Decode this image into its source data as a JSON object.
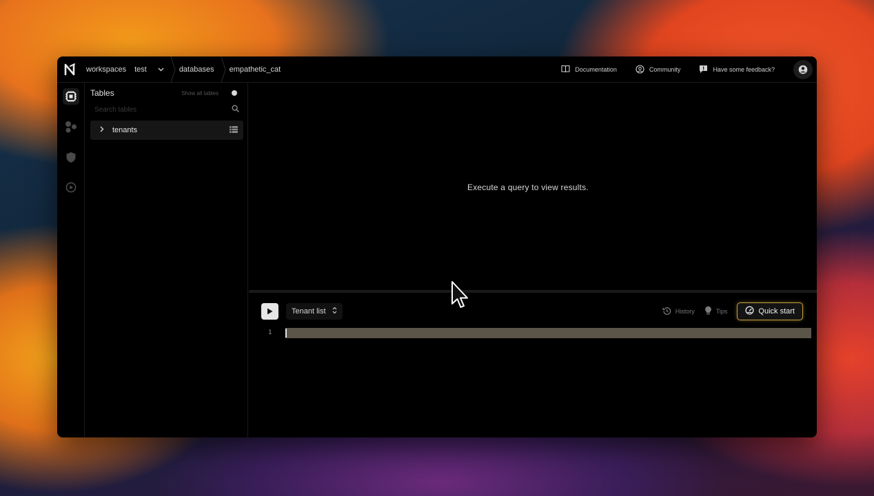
{
  "topbar": {
    "breadcrumbs": [
      "workspaces",
      "test",
      "databases",
      "empathetic_cat"
    ],
    "links": {
      "documentation": "Documentation",
      "community": "Community",
      "feedback": "Have some feedback?"
    }
  },
  "rail": {
    "icons": [
      "database-icon",
      "molecules-icon",
      "shield-icon",
      "play-circle-icon"
    ]
  },
  "tables_panel": {
    "title": "Tables",
    "show_all_label": "Show all tables",
    "show_all_enabled": true,
    "search_placeholder": "Search tables",
    "items": [
      {
        "name": "tenants"
      }
    ]
  },
  "results": {
    "empty_message": "Execute a query to view results."
  },
  "editor": {
    "query_name": "Tenant list",
    "history_label": "History",
    "tips_label": "Tips",
    "quick_start_label": "Quick start",
    "line_numbers": [
      "1"
    ],
    "accent": "#c9a13f"
  }
}
